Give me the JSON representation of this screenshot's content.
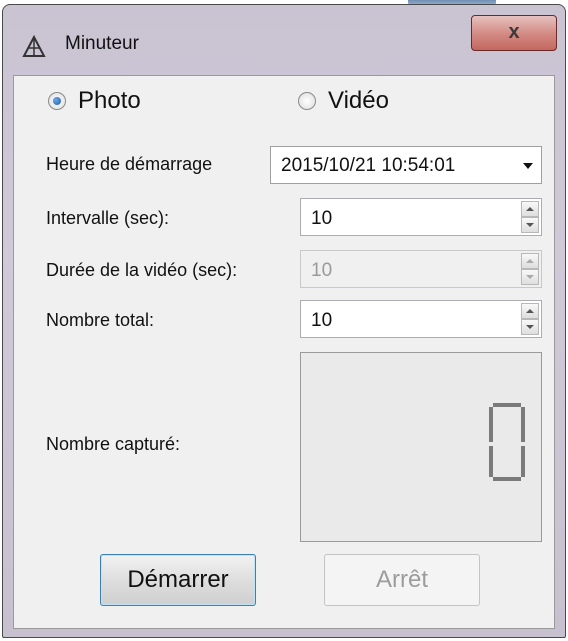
{
  "window": {
    "title": "Minuteur",
    "close_label": "x"
  },
  "mode": {
    "photo_label": "Photo",
    "video_label": "Vidéo",
    "selected": "Photo"
  },
  "start_time": {
    "label": "Heure de démarrage",
    "value": "2015/10/21 10:54:01"
  },
  "interval": {
    "label": "Intervalle (sec):",
    "value": "10"
  },
  "video_duration": {
    "label": "Durée de la vidéo (sec):",
    "value": "10",
    "enabled": false
  },
  "total_count": {
    "label": "Nombre total:",
    "value": "10"
  },
  "captured": {
    "label": "Nombre capturé:",
    "value": "0"
  },
  "buttons": {
    "start_label": "Démarrer",
    "stop_label": "Arrêt"
  }
}
